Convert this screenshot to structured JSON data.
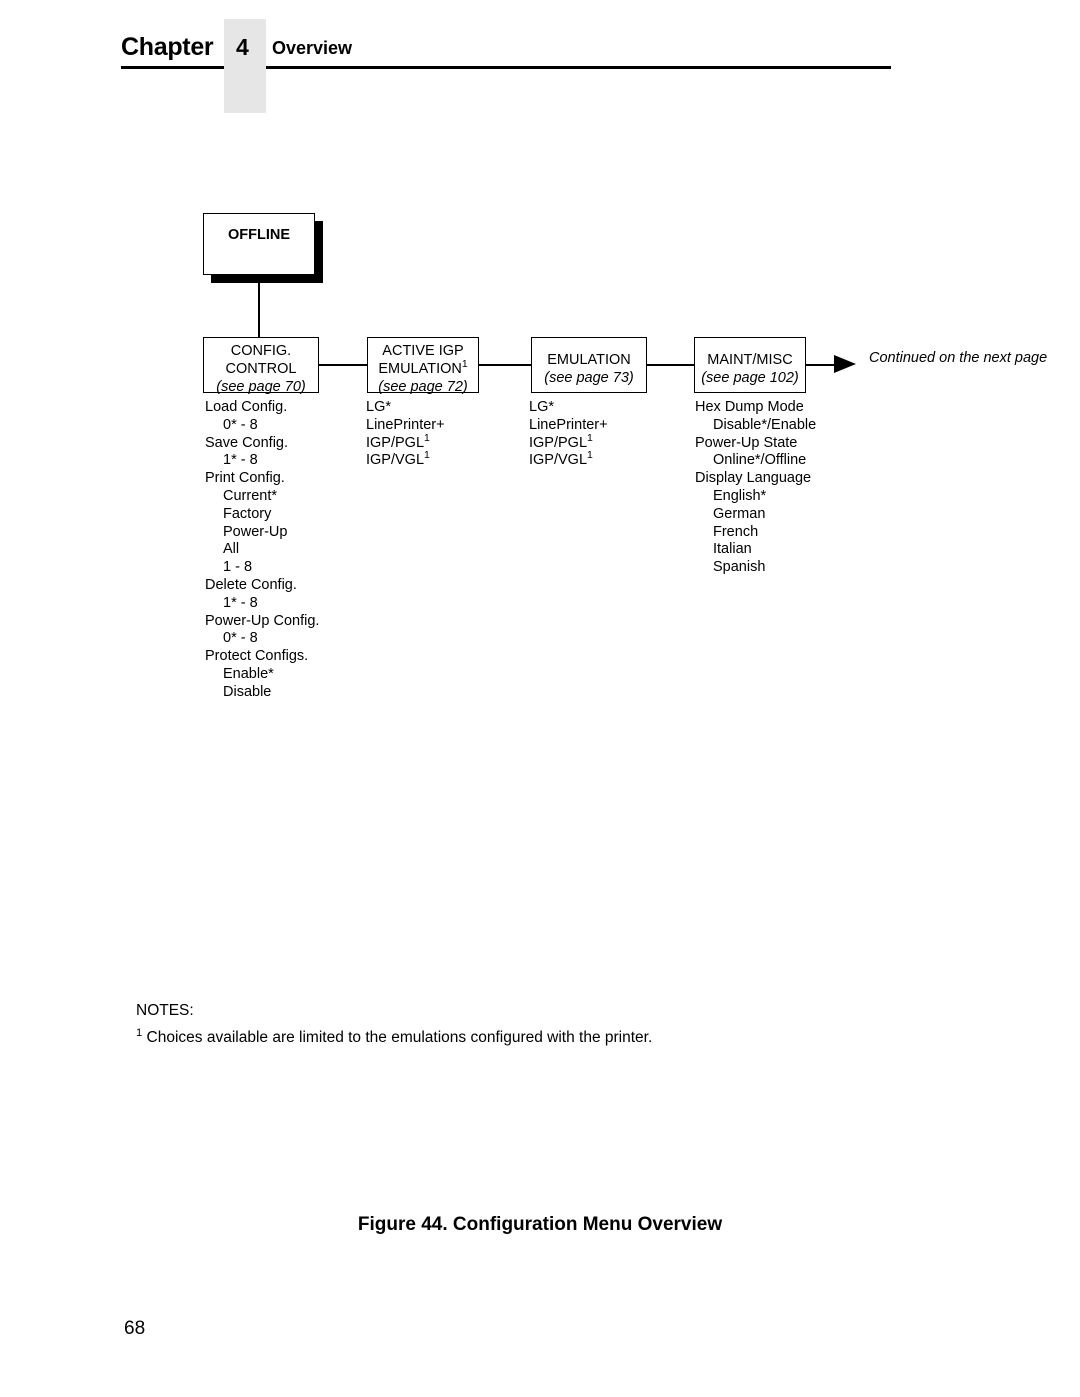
{
  "header": {
    "chapter_word": "Chapter",
    "chapter_number": "4",
    "title": "Overview"
  },
  "diagram": {
    "root": {
      "label": "OFFLINE"
    },
    "continued_note": {
      "line1": "Continued on",
      "line2": "the next page"
    },
    "arrow_icon": "right-arrow-icon",
    "columns": [
      {
        "id": "config-control",
        "box": {
          "line1": "CONFIG.",
          "line2": "CONTROL",
          "line3": "(see page 70)"
        },
        "items": [
          {
            "text": "Load Config.",
            "sub": false
          },
          {
            "text": "0* - 8",
            "sub": true
          },
          {
            "text": "Save Config.",
            "sub": false
          },
          {
            "text": "1* - 8",
            "sub": true
          },
          {
            "text": "Print Config.",
            "sub": false
          },
          {
            "text": "Current*",
            "sub": true
          },
          {
            "text": "Factory",
            "sub": true
          },
          {
            "text": "Power-Up",
            "sub": true
          },
          {
            "text": "All",
            "sub": true
          },
          {
            "text": "1 - 8",
            "sub": true
          },
          {
            "text": "Delete Config.",
            "sub": false
          },
          {
            "text": "1* - 8",
            "sub": true
          },
          {
            "text": "Power-Up Config.",
            "sub": false
          },
          {
            "text": "0* - 8",
            "sub": true
          },
          {
            "text": "Protect Configs.",
            "sub": false
          },
          {
            "text": "Enable*",
            "sub": true
          },
          {
            "text": "Disable",
            "sub": true
          }
        ]
      },
      {
        "id": "active-igp-emulation",
        "box": {
          "line1": "ACTIVE IGP",
          "line2": "EMULATION",
          "line2_sup": "1",
          "line3": "(see page 72)"
        },
        "items": [
          {
            "text": "LG*",
            "sub": false
          },
          {
            "text": "LinePrinter+",
            "sub": false
          },
          {
            "text": "IGP/PGL",
            "sup": "1",
            "sub": false
          },
          {
            "text": "IGP/VGL",
            "sup": "1",
            "sub": false
          }
        ]
      },
      {
        "id": "emulation",
        "box": {
          "line1": "EMULATION",
          "line2": "(see page 73)"
        },
        "items": [
          {
            "text": "LG*",
            "sub": false
          },
          {
            "text": "LinePrinter+",
            "sub": false
          },
          {
            "text": "IGP/PGL",
            "sup": "1",
            "sub": false
          },
          {
            "text": "IGP/VGL",
            "sup": "1",
            "sub": false
          }
        ]
      },
      {
        "id": "maint-misc",
        "box": {
          "line1": "MAINT/MISC",
          "line2": "(see page 102)"
        },
        "items": [
          {
            "text": "Hex Dump Mode",
            "sub": false
          },
          {
            "text": "Disable*/Enable",
            "sub": true
          },
          {
            "text": "Power-Up State",
            "sub": false
          },
          {
            "text": "Online*/Offline",
            "sub": true
          },
          {
            "text": "Display Language",
            "sub": false
          },
          {
            "text": "English*",
            "sub": true
          },
          {
            "text": "German",
            "sub": true
          },
          {
            "text": "French",
            "sub": true
          },
          {
            "text": "Italian",
            "sub": true
          },
          {
            "text": "Spanish",
            "sub": true
          }
        ]
      }
    ]
  },
  "notes": {
    "heading": "NOTES:",
    "marker_1": "1",
    "note_1": "Choices available are limited to the emulations configured with the printer."
  },
  "caption": "Figure 44. Configuration Menu Overview",
  "page_number": "68",
  "colors": {
    "ink": "#000000",
    "page": "#ffffff",
    "header_block": "#e6e6e6"
  }
}
